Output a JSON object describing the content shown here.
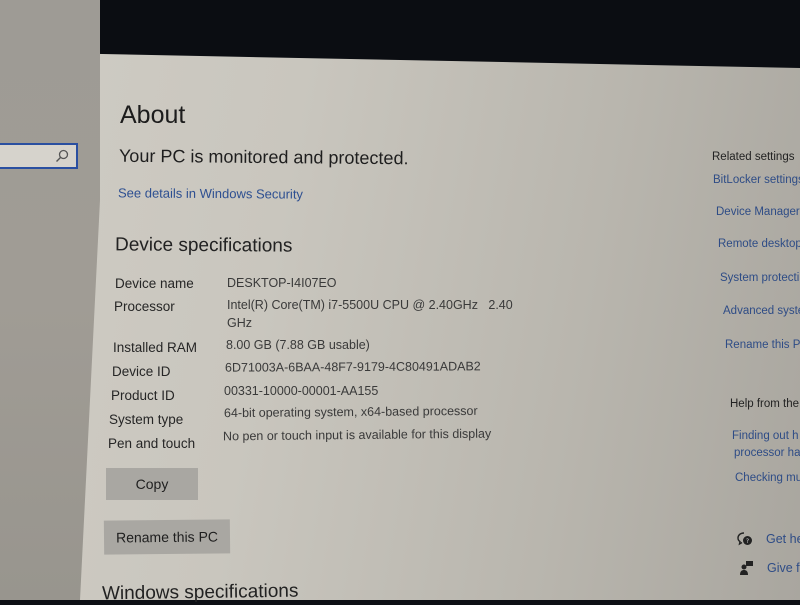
{
  "page": {
    "title": "About",
    "security_status": "Your PC is monitored and protected.",
    "security_link": "See details in Windows Security"
  },
  "sidebar": {
    "search": {
      "value": "",
      "placeholder": "",
      "icon": "search-icon"
    }
  },
  "device_specs": {
    "heading": "Device specifications",
    "rows": [
      {
        "label": "Device name",
        "value": "DESKTOP-I4I07EO"
      },
      {
        "label": "Processor",
        "value": "Intel(R) Core(TM) i7-5500U CPU @ 2.40GHz   2.40",
        "value_cont": "GHz"
      },
      {
        "label": "Installed RAM",
        "value": "8.00 GB (7.88 GB usable)"
      },
      {
        "label": "Device ID",
        "value": "6D71003A-6BAA-48F7-9179-4C80491ADAB2"
      },
      {
        "label": "Product ID",
        "value": "00331-10000-00001-AA155"
      },
      {
        "label": "System type",
        "value": "64-bit operating system, x64-based processor"
      },
      {
        "label": "Pen and touch",
        "value": "No pen or touch input is available for this display"
      }
    ],
    "copy_button": "Copy",
    "rename_button": "Rename this PC"
  },
  "windows_specs": {
    "heading": "Windows specifications"
  },
  "related": {
    "heading": "Related settings",
    "links": [
      "BitLocker settings",
      "Device Manager",
      "Remote desktop",
      "System protecti",
      "Advanced syste",
      "Rename this P"
    ]
  },
  "help": {
    "heading": "Help from the",
    "links": [
      {
        "line1": "Finding out h",
        "line2": "processor ha"
      },
      {
        "line1": "Checking mu"
      }
    ],
    "get_help": {
      "label": "Get he",
      "icon": "get-help-icon"
    },
    "feedback": {
      "label": "Give fe",
      "icon": "feedback-icon"
    }
  }
}
